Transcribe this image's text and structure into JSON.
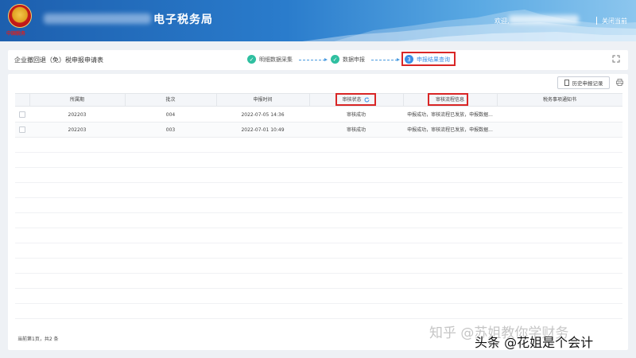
{
  "header": {
    "title": "电子税务局",
    "welcome": "欢迎,",
    "close_label": "关闭当前",
    "emblem_text": "中国税务",
    "bg_color": "#2a7ccc"
  },
  "titlebar": {
    "page_title": "企业撤回退（免）税申报申请表",
    "steps": [
      {
        "label": "明细数据采集",
        "status": "done"
      },
      {
        "label": "数据申报",
        "status": "done"
      },
      {
        "label": "申报结果查询",
        "number": "3",
        "status": "current"
      }
    ],
    "expand_icon": "expand-icon"
  },
  "toolbar": {
    "history_label": "历史申报记录",
    "history_icon": "document-icon",
    "print_icon": "print-icon"
  },
  "table": {
    "headers": [
      "所属期",
      "批次",
      "申报时间",
      "审核状态",
      "审核流程信息",
      "税务事项通知书"
    ],
    "refresh_icon": "refresh-icon",
    "rows": [
      {
        "period": "202203",
        "batch": "004",
        "time": "2022-07-05 14:36",
        "status": "审核成功",
        "flow": "申报成功，审核流程已发放，申报数据..."
      },
      {
        "period": "202203",
        "batch": "003",
        "time": "2022-07-01 10:49",
        "status": "审核成功",
        "flow": "申报成功，审核流程已发放，申报数据..."
      }
    ]
  },
  "footer": {
    "pagination": "当前第1页，共2 条"
  },
  "watermark": {
    "zhihu": "知乎 @苏姐教你学财务",
    "toutiao": "头条 @花姐是个会计"
  },
  "colors": {
    "accent": "#3a8ee6",
    "done": "#2fbfa0",
    "highlight": "#d92626"
  }
}
